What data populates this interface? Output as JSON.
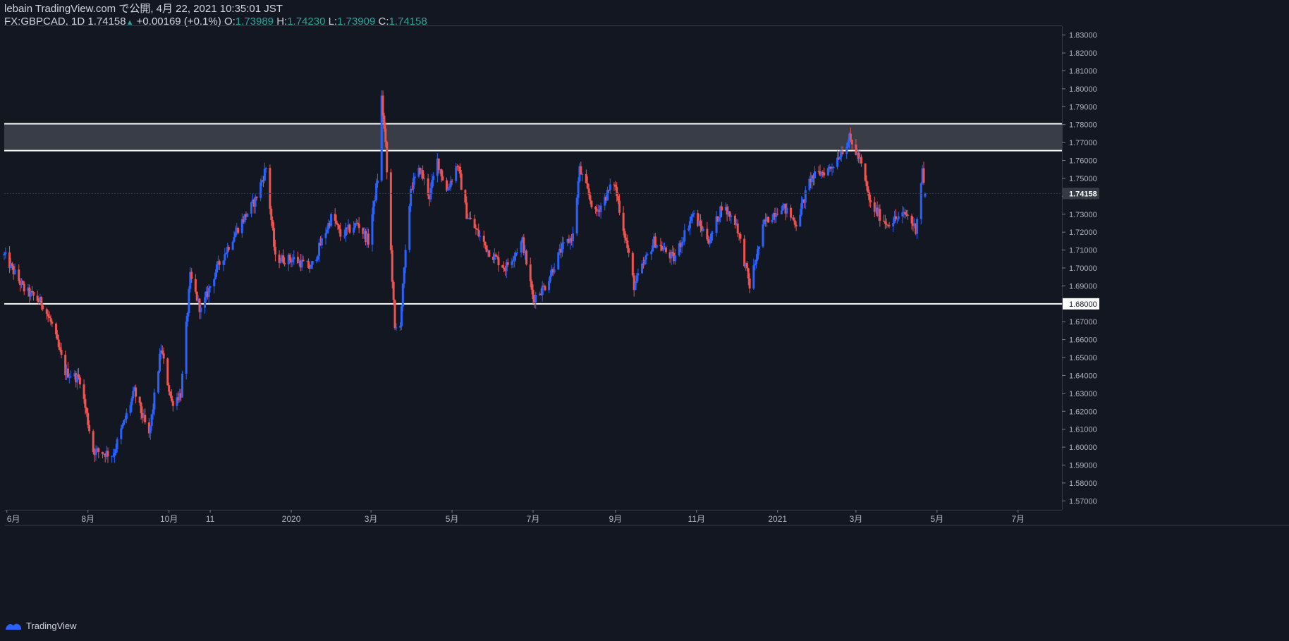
{
  "header": {
    "publish_line": "lebain TradingView.com で公開, 4月 22, 2021 10:35:01 JST",
    "symbol": "FX:GBPCAD, 1D",
    "last": "1.74158",
    "change": "+0.00169 (+0.1%)",
    "o_label": "O:",
    "o_value": "1.73989",
    "h_label": "H:",
    "h_value": "1.74230",
    "l_label": "L:",
    "l_value": "1.73909",
    "c_label": "C:",
    "c_value": "1.74158"
  },
  "footer": {
    "brand": "TradingView"
  },
  "colors": {
    "background": "#131722",
    "up": "#2962ff",
    "down": "#ef5350",
    "zone": "#3b3f4a",
    "level_line": "#ffffff",
    "axis_text": "#b2b5be"
  },
  "chart_data": {
    "type": "candlestick",
    "symbol": "GBPCAD",
    "interval": "1D",
    "y_range": [
      1.565,
      1.835
    ],
    "y_ticks": [
      "1.83000",
      "1.82000",
      "1.81000",
      "1.80000",
      "1.79000",
      "1.78000",
      "1.77000",
      "1.76000",
      "1.75000",
      "1.74000",
      "1.73000",
      "1.72000",
      "1.71000",
      "1.70000",
      "1.69000",
      "1.68000",
      "1.67000",
      "1.66000",
      "1.65000",
      "1.64000",
      "1.63000",
      "1.62000",
      "1.61000",
      "1.60000",
      "1.59000",
      "1.58000",
      "1.57000"
    ],
    "x_labels": [
      "6月",
      "8月",
      "10月",
      "11",
      "2020",
      "3月",
      "5月",
      "7月",
      "9月",
      "11月",
      "2021",
      "3月",
      "5月",
      "7月"
    ],
    "x_label_dates": [
      "2019-06",
      "2019-08",
      "2019-10",
      "2019-11",
      "2020-01",
      "2020-03",
      "2020-05",
      "2020-07",
      "2020-09",
      "2020-11",
      "2021-01",
      "2021-03",
      "2021-05",
      "2021-07"
    ],
    "last_price_label": "1.74158",
    "support_label": "1.68000",
    "resistance_zone": [
      1.7655,
      1.7805
    ],
    "support_line": 1.68,
    "path_anchors": [
      [
        "2019-05-30",
        1.707
      ],
      [
        "2019-06-14",
        1.688
      ],
      [
        "2019-06-28",
        1.68
      ],
      [
        "2019-07-05",
        1.668
      ],
      [
        "2019-07-15",
        1.642
      ],
      [
        "2019-07-26",
        1.638
      ],
      [
        "2019-08-05",
        1.598
      ],
      [
        "2019-08-20",
        1.596
      ],
      [
        "2019-09-05",
        1.631
      ],
      [
        "2019-09-16",
        1.606
      ],
      [
        "2019-09-25",
        1.655
      ],
      [
        "2019-10-03",
        1.625
      ],
      [
        "2019-10-10",
        1.63
      ],
      [
        "2019-10-17",
        1.695
      ],
      [
        "2019-10-25",
        1.676
      ],
      [
        "2019-11-05",
        1.698
      ],
      [
        "2019-11-20",
        1.72
      ],
      [
        "2019-12-05",
        1.738
      ],
      [
        "2019-12-13",
        1.756
      ],
      [
        "2019-12-20",
        1.705
      ],
      [
        "2020-01-03",
        1.705
      ],
      [
        "2020-01-16",
        1.7
      ],
      [
        "2020-02-01",
        1.73
      ],
      [
        "2020-02-07",
        1.718
      ],
      [
        "2020-02-20",
        1.725
      ],
      [
        "2020-02-28",
        1.715
      ],
      [
        "2020-03-06",
        1.75
      ],
      [
        "2020-03-09",
        1.795
      ],
      [
        "2020-03-12",
        1.768
      ],
      [
        "2020-03-19",
        1.665
      ],
      [
        "2020-03-23",
        1.67
      ],
      [
        "2020-03-31",
        1.745
      ],
      [
        "2020-04-07",
        1.755
      ],
      [
        "2020-04-14",
        1.74
      ],
      [
        "2020-04-20",
        1.76
      ],
      [
        "2020-04-27",
        1.743
      ],
      [
        "2020-05-05",
        1.758
      ],
      [
        "2020-05-12",
        1.73
      ],
      [
        "2020-05-28",
        1.71
      ],
      [
        "2020-06-10",
        1.7
      ],
      [
        "2020-06-23",
        1.715
      ],
      [
        "2020-07-01",
        1.683
      ],
      [
        "2020-07-10",
        1.69
      ],
      [
        "2020-07-22",
        1.71
      ],
      [
        "2020-07-31",
        1.718
      ],
      [
        "2020-08-05",
        1.755
      ],
      [
        "2020-08-17",
        1.73
      ],
      [
        "2020-08-31",
        1.748
      ],
      [
        "2020-09-09",
        1.715
      ],
      [
        "2020-09-15",
        1.69
      ],
      [
        "2020-09-30",
        1.715
      ],
      [
        "2020-10-15",
        1.705
      ],
      [
        "2020-10-29",
        1.73
      ],
      [
        "2020-11-11",
        1.715
      ],
      [
        "2020-11-20",
        1.735
      ],
      [
        "2020-12-01",
        1.725
      ],
      [
        "2020-12-11",
        1.69
      ],
      [
        "2020-12-22",
        1.725
      ],
      [
        "2021-01-04",
        1.735
      ],
      [
        "2021-01-15",
        1.725
      ],
      [
        "2021-01-26",
        1.75
      ],
      [
        "2021-02-10",
        1.756
      ],
      [
        "2021-02-24",
        1.772
      ],
      [
        "2021-03-04",
        1.76
      ],
      [
        "2021-03-12",
        1.735
      ],
      [
        "2021-03-24",
        1.725
      ],
      [
        "2021-04-08",
        1.73
      ],
      [
        "2021-04-15",
        1.722
      ],
      [
        "2021-04-20",
        1.755
      ],
      [
        "2021-04-22",
        1.7416
      ]
    ]
  }
}
